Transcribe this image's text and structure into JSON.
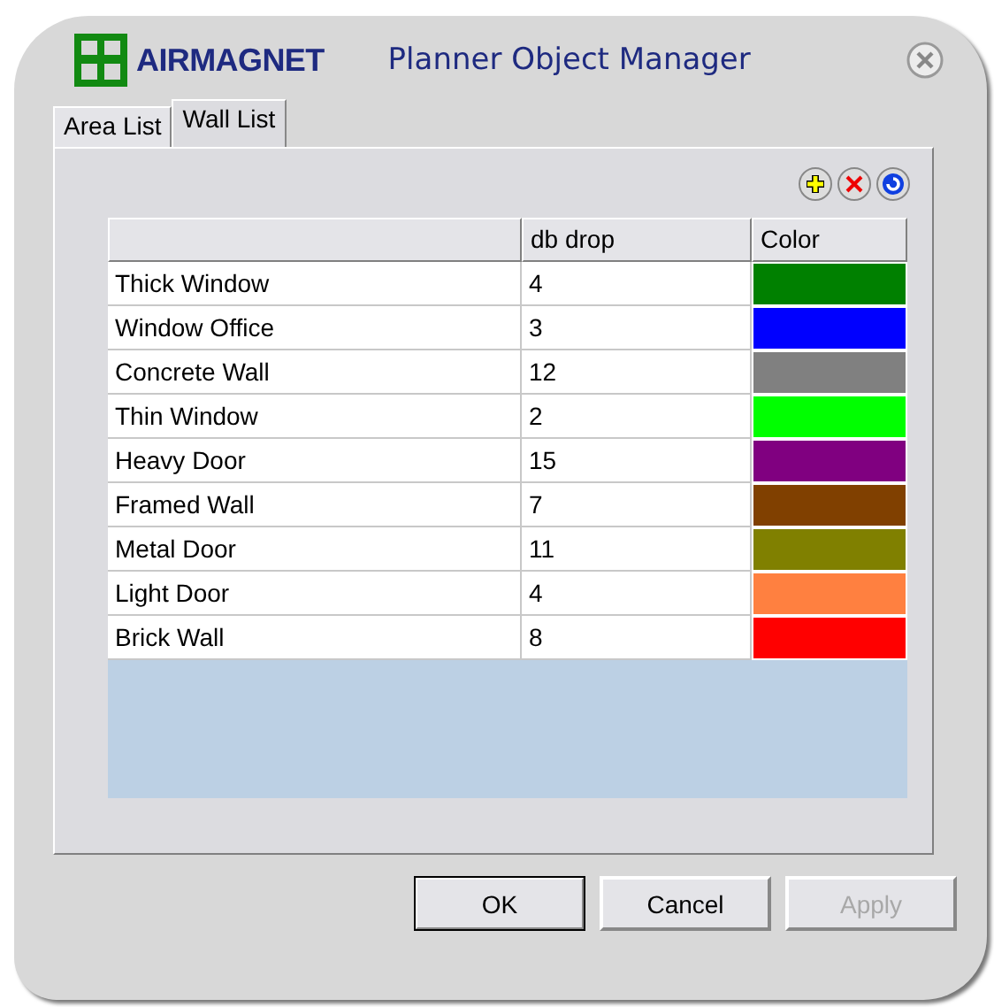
{
  "window": {
    "logo": "AIRMAGNET",
    "title": "Planner Object Manager"
  },
  "tabs": [
    {
      "label": "Area List",
      "selected": false
    },
    {
      "label": "Wall List",
      "selected": true
    }
  ],
  "table": {
    "columns": [
      "db drop",
      "Color"
    ],
    "rows": [
      {
        "name": "Thick Window",
        "db_drop": "4",
        "color": "#008000"
      },
      {
        "name": "Window Office",
        "db_drop": "3",
        "color": "#0000ff"
      },
      {
        "name": "Concrete Wall",
        "db_drop": "12",
        "color": "#808080"
      },
      {
        "name": "Thin Window",
        "db_drop": "2",
        "color": "#00ff00"
      },
      {
        "name": "Heavy Door",
        "db_drop": "15",
        "color": "#800080"
      },
      {
        "name": "Framed Wall",
        "db_drop": "7",
        "color": "#804000"
      },
      {
        "name": "Metal Door",
        "db_drop": "11",
        "color": "#808000"
      },
      {
        "name": "Light Door",
        "db_drop": "4",
        "color": "#ff8040"
      },
      {
        "name": "Brick Wall",
        "db_drop": "8",
        "color": "#ff0000"
      }
    ]
  },
  "buttons": [
    {
      "label": "OK",
      "default": true,
      "disabled": false
    },
    {
      "label": "Cancel",
      "default": false,
      "disabled": false
    },
    {
      "label": "Apply",
      "default": false,
      "disabled": true
    }
  ]
}
